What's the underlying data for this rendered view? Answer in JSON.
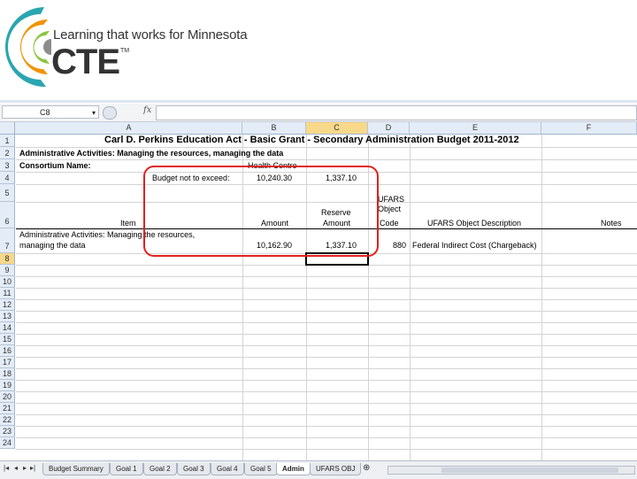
{
  "logo": {
    "tagline": "Learning that works for Minnesota",
    "wordmark": "CTE",
    "trademark": "TM",
    "colors": {
      "teal": "#2aa6b0",
      "orange": "#f39200",
      "green": "#8cc63f",
      "gray": "#8c8c8c"
    }
  },
  "formula_bar": {
    "name_box": "C8",
    "fx": "fx",
    "content": ""
  },
  "columns": [
    "A",
    "B",
    "C",
    "D",
    "E",
    "F"
  ],
  "selected_column": "C",
  "rows": [
    "1",
    "2",
    "3",
    "4",
    "5",
    "6",
    "7",
    "8",
    "9",
    "10",
    "11",
    "12",
    "13",
    "14",
    "15",
    "16",
    "17",
    "18",
    "19",
    "20",
    "21",
    "22",
    "23",
    "24"
  ],
  "selected_row": "8",
  "sheet": {
    "title": "Carl D. Perkins Education Act - Basic Grant - Secondary Administration Budget  2011-2012",
    "r2_label": "Administrative Activities: Managing the resources, managing the data",
    "r3_label": "Consortium Name:",
    "r3_health": "Health Centre",
    "r4_label": "Budget not to exceed:",
    "r4_amount": "10,240.30",
    "r4_reserve": "1,337.10",
    "r5_ufars": "UFARS",
    "r5_object": "Object",
    "r6_item": "Item",
    "r6_amount": "Amount",
    "r6_reserve1": "Reserve",
    "r6_reserve2": "Amount",
    "r6_code": "Code",
    "r6_desc": "UFARS Object Description",
    "r6_notes": "Notes",
    "r7_item1": "Administrative Activities: Managing the resources,",
    "r7_item2": "managing the data",
    "r7_amount": "10,162.90",
    "r7_reserve": "1,337.10",
    "r7_code": "880",
    "r7_desc": "Federal Indirect Cost (Chargeback)"
  },
  "tabs": [
    "Budget Summary",
    "Goal 1",
    "Goal 2",
    "Goal 3",
    "Goal 4",
    "Goal 5",
    "Admin",
    "UFARS OBJ"
  ],
  "active_tab": "Admin",
  "highlight_color": "#e02020"
}
